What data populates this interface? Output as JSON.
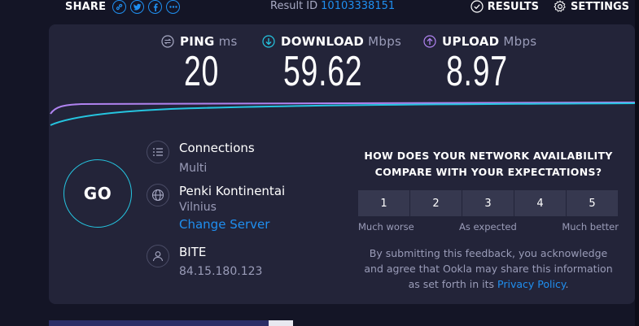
{
  "topbar": {
    "share_label": "SHARE",
    "share_icons": [
      "link-icon",
      "twitter-icon",
      "facebook-icon",
      "more-icon"
    ],
    "result_label": "Result ID",
    "result_id": "10103338151",
    "results_label": "RESULTS",
    "settings_label": "SETTINGS"
  },
  "metrics": {
    "ping": {
      "label": "PING",
      "unit": "ms",
      "value": "20"
    },
    "download": {
      "label": "DOWNLOAD",
      "unit": "Mbps",
      "value": "59.62"
    },
    "upload": {
      "label": "UPLOAD",
      "unit": "Mbps",
      "value": "8.97"
    }
  },
  "colors": {
    "accent_blue": "#1f8ff0",
    "download_cyan": "#25c5e0",
    "upload_purple": "#b083f0",
    "card_bg": "#232439",
    "page_bg": "#141526"
  },
  "go_button": {
    "label": "GO"
  },
  "connections": {
    "title": "Connections",
    "value": "Multi"
  },
  "server": {
    "name": "Penki Kontinentai",
    "location": "Vilnius",
    "change_label": "Change Server"
  },
  "provider": {
    "name": "BITE",
    "ip": "84.15.180.123"
  },
  "feedback": {
    "question_line1": "HOW DOES YOUR NETWORK AVAILABILITY",
    "question_line2": "COMPARE WITH YOUR EXPECTATIONS?",
    "ratings": [
      "1",
      "2",
      "3",
      "4",
      "5"
    ],
    "low_label": "Much worse",
    "mid_label": "As expected",
    "high_label": "Much better",
    "note_line1": "By submitting this feedback, you acknowledge",
    "note_line2": "and agree that Ookla may share this information",
    "note_line3_prefix": "as set forth in its",
    "privacy_link": "Privacy Policy",
    "note_suffix": "."
  }
}
